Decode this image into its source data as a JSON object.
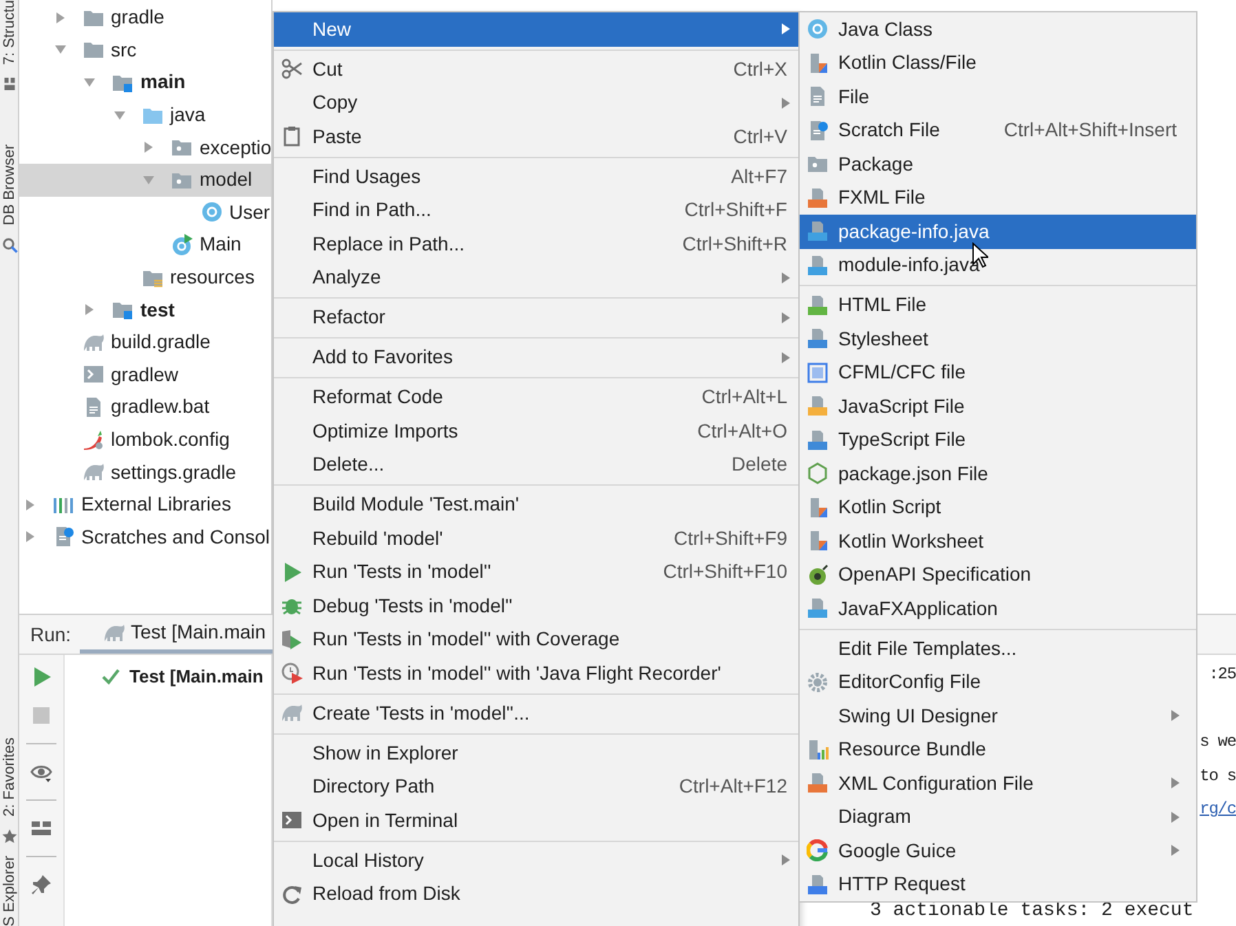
{
  "tool_strip": {
    "top": [
      {
        "label": "7: Structu",
        "kind": "structure"
      },
      {
        "label": "DB Browser",
        "kind": "search"
      }
    ],
    "bottom": [
      {
        "label": "2: Favorites",
        "kind": "star"
      },
      {
        "label": "S Explorer"
      }
    ]
  },
  "project_tree": {
    "root_children": [
      {
        "label": "gradle",
        "kind": "folder",
        "expanded": false,
        "selected": false
      },
      {
        "label": "src",
        "kind": "folder",
        "expanded": true,
        "selected": false,
        "children": [
          {
            "label": "main",
            "kind": "folder-source",
            "expanded": true,
            "selected": false,
            "children": [
              {
                "label": "java",
                "kind": "folder-java",
                "expanded": true,
                "selected": false,
                "children": [
                  {
                    "label": "exceptio",
                    "kind": "package",
                    "expanded": false,
                    "selected": false
                  },
                  {
                    "label": "model",
                    "kind": "package",
                    "expanded": true,
                    "selected": true,
                    "children": [
                      {
                        "label": "User",
                        "kind": "class",
                        "selected": false
                      }
                    ]
                  },
                  {
                    "label": "Main",
                    "kind": "main-class",
                    "selected": false
                  }
                ]
              },
              {
                "label": "resources",
                "kind": "resources",
                "selected": false
              }
            ]
          },
          {
            "label": "test",
            "kind": "folder-source",
            "expanded": false,
            "selected": false
          }
        ]
      },
      {
        "label": "build.gradle",
        "kind": "elephant",
        "selected": false
      },
      {
        "label": "gradlew",
        "kind": "terminal",
        "selected": false
      },
      {
        "label": "gradlew.bat",
        "kind": "doc",
        "selected": false
      },
      {
        "label": "lombok.config",
        "kind": "lombok",
        "selected": false
      },
      {
        "label": "settings.gradle",
        "kind": "elephant",
        "selected": false
      }
    ],
    "top_level": [
      {
        "label": "External Libraries",
        "kind": "libraries",
        "expanded": false,
        "selected": false
      },
      {
        "label": "Scratches and Consol",
        "kind": "scratches",
        "expanded": false,
        "selected": false
      }
    ]
  },
  "run_panel": {
    "title": "Run:",
    "tab": {
      "label": "Test [Main.main",
      "selected": true
    },
    "results": [
      {
        "label": "Test [Main.main",
        "passed": true
      }
    ],
    "console": [
      {
        "kind": "clipped",
        "text": ":25"
      },
      {
        "kind": "blank"
      },
      {
        "kind": "clipped",
        "text": "s we"
      },
      {
        "kind": "clipped",
        "text": "to s"
      },
      {
        "kind": "link",
        "text": "rg/c"
      },
      {
        "kind": "blank"
      },
      {
        "kind": "blank"
      },
      {
        "kind": "text",
        "text": "3 actionable tasks: 2 execut"
      }
    ]
  },
  "context_menu": {
    "groups": [
      {
        "items": [
          {
            "label": "New",
            "submenu": true,
            "selected": true
          }
        ]
      },
      {
        "items": [
          {
            "label": "Cut",
            "shortcut": "Ctrl+X",
            "kind": "scissors",
            "submenu": false,
            "selected": false
          },
          {
            "label": "Copy",
            "submenu": true,
            "selected": false
          },
          {
            "label": "Paste",
            "shortcut": "Ctrl+V",
            "kind": "clipboard",
            "submenu": false,
            "selected": false
          }
        ]
      },
      {
        "items": [
          {
            "label": "Find Usages",
            "shortcut": "Alt+F7",
            "submenu": false,
            "selected": false
          },
          {
            "label": "Find in Path...",
            "shortcut": "Ctrl+Shift+F",
            "submenu": false,
            "selected": false
          },
          {
            "label": "Replace in Path...",
            "shortcut": "Ctrl+Shift+R",
            "submenu": false,
            "selected": false
          },
          {
            "label": "Analyze",
            "submenu": true,
            "selected": false
          }
        ]
      },
      {
        "items": [
          {
            "label": "Refactor",
            "submenu": true,
            "selected": false
          }
        ]
      },
      {
        "items": [
          {
            "label": "Add to Favorites",
            "submenu": true,
            "selected": false
          }
        ]
      },
      {
        "items": [
          {
            "label": "Reformat Code",
            "shortcut": "Ctrl+Alt+L",
            "submenu": false,
            "selected": false
          },
          {
            "label": "Optimize Imports",
            "shortcut": "Ctrl+Alt+O",
            "submenu": false,
            "selected": false
          },
          {
            "label": "Delete...",
            "shortcut": "Delete",
            "submenu": false,
            "selected": false
          }
        ]
      },
      {
        "items": [
          {
            "label": "Build Module 'Test.main'",
            "submenu": false,
            "selected": false
          },
          {
            "label": "Rebuild 'model'",
            "shortcut": "Ctrl+Shift+F9",
            "submenu": false,
            "selected": false
          },
          {
            "label": "Run 'Tests in 'model''",
            "shortcut": "Ctrl+Shift+F10",
            "kind": "play",
            "submenu": false,
            "selected": false
          },
          {
            "label": "Debug 'Tests in 'model''",
            "kind": "bug",
            "submenu": false,
            "selected": false
          },
          {
            "label": "Run 'Tests in 'model'' with Coverage",
            "kind": "coverage",
            "submenu": false,
            "selected": false
          },
          {
            "label": "Run 'Tests in 'model'' with 'Java Flight Recorder'",
            "kind": "jfr",
            "submenu": false,
            "selected": false
          }
        ]
      },
      {
        "items": [
          {
            "label": "Create 'Tests in 'model''...",
            "kind": "elephant",
            "submenu": false,
            "selected": false
          }
        ]
      },
      {
        "items": [
          {
            "label": "Show in Explorer",
            "submenu": false,
            "selected": false
          },
          {
            "label": "Directory Path",
            "shortcut": "Ctrl+Alt+F12",
            "submenu": false,
            "selected": false
          },
          {
            "label": "Open in Terminal",
            "kind": "terminal-dark",
            "submenu": false,
            "selected": false
          }
        ]
      },
      {
        "items": [
          {
            "label": "Local History",
            "submenu": true,
            "selected": false
          },
          {
            "label": "Reload from Disk",
            "kind": "reload",
            "submenu": false,
            "selected": false
          }
        ]
      }
    ]
  },
  "new_submenu": {
    "groups": [
      {
        "items": [
          {
            "label": "Java Class",
            "kind": "class",
            "submenu": false,
            "selected": false
          },
          {
            "label": "Kotlin Class/File",
            "kind": "kotlin",
            "submenu": false,
            "selected": false
          },
          {
            "label": "File",
            "kind": "doc",
            "submenu": false,
            "selected": false
          },
          {
            "label": "Scratch File",
            "shortcut": "Ctrl+Alt+Shift+Insert",
            "kind": "scratches",
            "submenu": false,
            "selected": false
          },
          {
            "label": "Package",
            "kind": "package",
            "submenu": false,
            "selected": false
          },
          {
            "label": "FXML File",
            "kind": "fxml",
            "submenu": false,
            "selected": false
          },
          {
            "label": "package-info.java",
            "kind": "java-file",
            "submenu": false,
            "selected": true
          },
          {
            "label": "module-info.java",
            "kind": "java-file",
            "submenu": false,
            "selected": false
          }
        ]
      },
      {
        "items": [
          {
            "label": "HTML File",
            "kind": "html",
            "submenu": false,
            "selected": false
          },
          {
            "label": "Stylesheet",
            "kind": "css",
            "submenu": false,
            "selected": false
          },
          {
            "label": "CFML/CFC file",
            "kind": "cfml",
            "submenu": false,
            "selected": false
          },
          {
            "label": "JavaScript File",
            "kind": "js",
            "submenu": false,
            "selected": false
          },
          {
            "label": "TypeScript File",
            "kind": "ts",
            "submenu": false,
            "selected": false
          },
          {
            "label": "package.json File",
            "kind": "nodejs",
            "submenu": false,
            "selected": false
          },
          {
            "label": "Kotlin Script",
            "kind": "kotlin",
            "submenu": false,
            "selected": false
          },
          {
            "label": "Kotlin Worksheet",
            "kind": "kotlin",
            "submenu": false,
            "selected": false
          },
          {
            "label": "OpenAPI Specification",
            "kind": "openapi",
            "submenu": false,
            "selected": false
          },
          {
            "label": "JavaFXApplication",
            "kind": "java-file",
            "submenu": false,
            "selected": false
          }
        ]
      },
      {
        "items": [
          {
            "label": "Edit File Templates...",
            "submenu": false,
            "selected": false
          },
          {
            "label": "EditorConfig File",
            "kind": "gear",
            "submenu": false,
            "selected": false
          },
          {
            "label": "Swing UI Designer",
            "submenu": true,
            "selected": false
          },
          {
            "label": "Resource Bundle",
            "kind": "bundle",
            "submenu": false,
            "selected": false
          },
          {
            "label": "XML Configuration File",
            "kind": "xml",
            "submenu": true,
            "selected": false
          },
          {
            "label": "Diagram",
            "submenu": true,
            "selected": false
          },
          {
            "label": "Google Guice",
            "kind": "google",
            "submenu": true,
            "selected": false
          },
          {
            "label": "HTTP Request",
            "kind": "api",
            "submenu": false,
            "selected": false
          }
        ]
      }
    ]
  }
}
